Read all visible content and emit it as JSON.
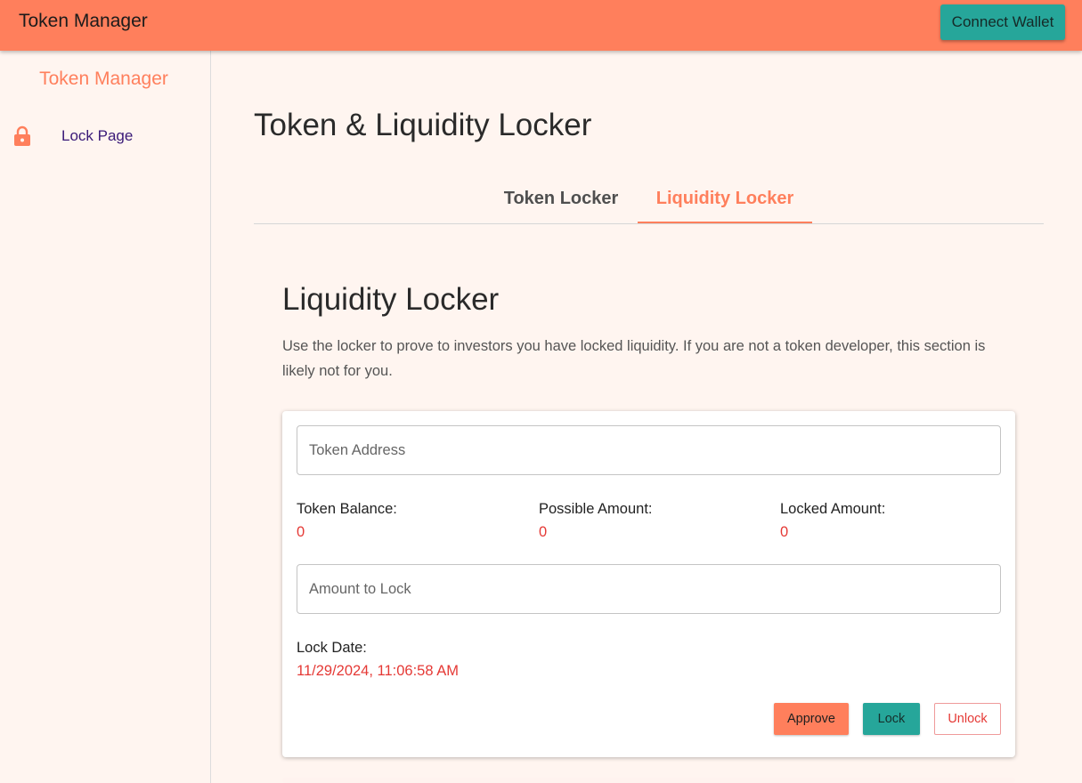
{
  "app": {
    "title": "Token Manager",
    "connect_label": "Connect Wallet"
  },
  "sidebar": {
    "title": "Token Manager",
    "items": [
      {
        "label": "Lock Page",
        "icon": "lock-icon"
      }
    ]
  },
  "main": {
    "page_title": "Token & Liquidity Locker",
    "tabs": [
      {
        "label": "Token Locker"
      },
      {
        "label": "Liquidity Locker",
        "active": true
      }
    ]
  },
  "section": {
    "title": "Liquidity Locker",
    "description": "Use the locker to prove to investors you have locked liquidity. If you are not a token developer, this section is likely not for you."
  },
  "form": {
    "token_address_placeholder": "Token Address",
    "token_address_value": "",
    "stats": [
      {
        "label": "Token Balance:",
        "value": "0"
      },
      {
        "label": "Possible Amount:",
        "value": "0"
      },
      {
        "label": "Locked Amount:",
        "value": "0"
      }
    ],
    "amount_placeholder": "Amount to Lock",
    "amount_value": "",
    "lock_date_label": "Lock Date:",
    "lock_date_value": "11/29/2024, 11:06:58 AM",
    "buttons": {
      "approve": "Approve",
      "lock": "Lock",
      "unlock": "Unlock"
    }
  },
  "colors": {
    "accent": "#ff7f5c",
    "teal": "#26a69a",
    "error_red": "#e53935",
    "background": "#fff5f0"
  }
}
